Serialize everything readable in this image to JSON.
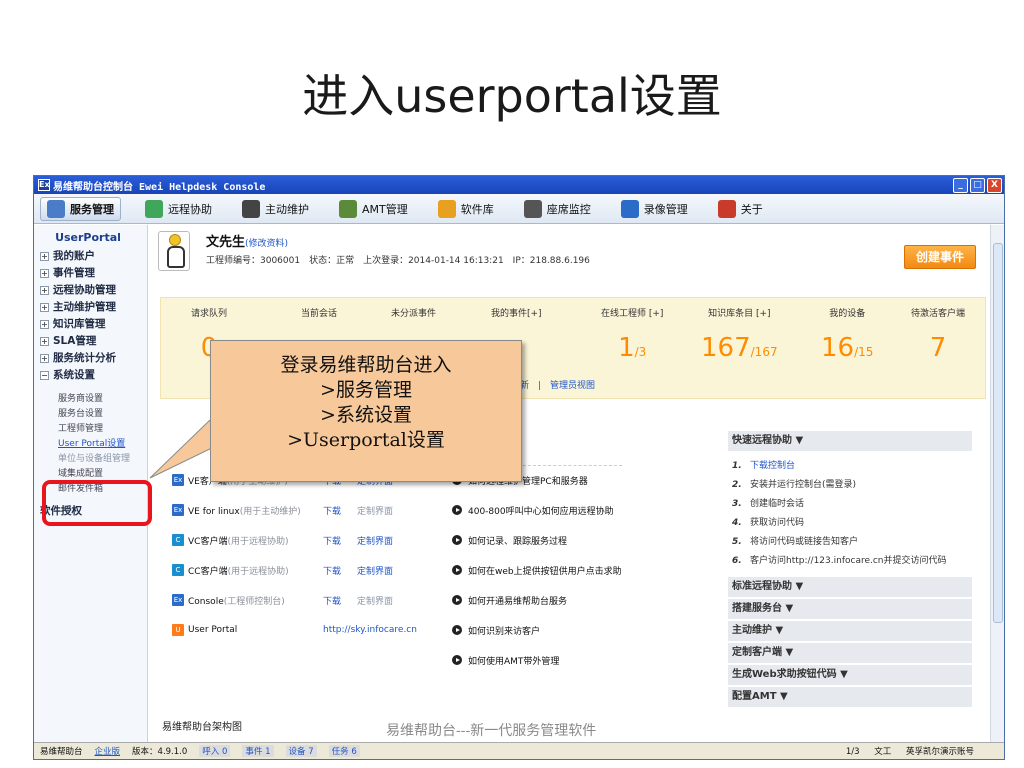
{
  "slide": {
    "title": "进入userportal设置",
    "callout_lines": [
      "登录易维帮助台进入",
      ">服务管理",
      ">系统设置",
      ">Userportal设置"
    ],
    "watermark": "易维帮助台---新一代服务管理软件"
  },
  "window": {
    "title": "易维帮助台控制台 Ewei Helpdesk Console",
    "icon": "Ex",
    "buttons": {
      "minimize": "_",
      "maximize": "□",
      "close": "X"
    }
  },
  "menu": [
    {
      "label": "服务管理",
      "color": "#4a7cc7"
    },
    {
      "label": "远程协助",
      "color": "#3fa65a"
    },
    {
      "label": "主动维护",
      "color": "#444444"
    },
    {
      "label": "AMT管理",
      "color": "#5a8a3a"
    },
    {
      "label": "软件库",
      "color": "#e8a020"
    },
    {
      "label": "座席监控",
      "color": "#555555"
    },
    {
      "label": "录像管理",
      "color": "#2a6cc8"
    },
    {
      "label": "关于",
      "color": "#c83a2a"
    }
  ],
  "sidebar": {
    "header": "UserPortal",
    "items": [
      {
        "label": "我的账户",
        "sign": "+"
      },
      {
        "label": "事件管理",
        "sign": "+"
      },
      {
        "label": "远程协助管理",
        "sign": "+"
      },
      {
        "label": "主动维护管理",
        "sign": "+"
      },
      {
        "label": "知识库管理",
        "sign": "+"
      },
      {
        "label": "SLA管理",
        "sign": "+"
      },
      {
        "label": "服务统计分析",
        "sign": "+"
      },
      {
        "label": "系统设置",
        "sign": "−"
      }
    ],
    "subs": [
      "服务商设置",
      "服务台设置",
      "工程师管理",
      "User Portal设置",
      "单位与设备组管理",
      "域集成配置",
      "邮件发件箱"
    ],
    "license": "软件授权"
  },
  "profile": {
    "name": "文先生",
    "edit": "(修改资料)",
    "info": "工程师编号：3006001　状态：正常　上次登录：2014-01-14 16:13:21　IP：218.88.6.196",
    "create_button": "创建事件"
  },
  "stats": [
    {
      "label": "请求队列",
      "value": "0",
      "sub": ""
    },
    {
      "label": "当前会话",
      "value": "",
      "sub": ""
    },
    {
      "label": "未分派事件",
      "value": "",
      "sub": ""
    },
    {
      "label": "我的事件[+]",
      "value": "",
      "sub": "7"
    },
    {
      "label": "在线工程师 [+]",
      "value": "1",
      "sub": "/3"
    },
    {
      "label": "知识库条目 [+]",
      "value": "167",
      "sub": "/167"
    },
    {
      "label": "我的设备",
      "value": "16",
      "sub": "/15"
    },
    {
      "label": "待激活客户端",
      "value": "7",
      "sub": ""
    }
  ],
  "stat_links": "刷新　|　管理员视图",
  "downloads": [
    {
      "icon": "Ex",
      "name": "VE客户端",
      "note": "(用于主动维护)",
      "download": "下载",
      "custom": "定制界面",
      "custom_gray": false
    },
    {
      "icon": "Ex",
      "name": "VE for linux",
      "note": "(用于主动维护)",
      "download": "下载",
      "custom": "定制界面",
      "custom_gray": true
    },
    {
      "icon": "C",
      "name": "VC客户端",
      "note": "(用于远程协助)",
      "download": "下载",
      "custom": "定制界面",
      "custom_gray": false
    },
    {
      "icon": "C",
      "name": "CC客户端",
      "note": "(用于远程协助)",
      "download": "下载",
      "custom": "定制界面",
      "custom_gray": false
    },
    {
      "icon": "Ex",
      "name": "Console",
      "note": "(工程师控制台)",
      "download": "下载",
      "custom": "定制界面",
      "custom_gray": true
    },
    {
      "icon": "U",
      "name": "User Portal",
      "note": "",
      "download": "http://sky.infocare.cn",
      "custom": "",
      "custom_gray": false
    }
  ],
  "faq": [
    "如何远程维护管理PC和服务器",
    "400-800呼叫中心如何应用远程协助",
    "如何记录、跟踪服务过程",
    "如何在web上提供按钮供用户点击求助",
    "如何开通易维帮助台服务",
    "如何识别来访客户",
    "如何使用AMT带外管理"
  ],
  "right_panel": {
    "quick_head": "快速远程协助 ▼",
    "quick_steps": [
      {
        "n": "1.",
        "text": "下载控制台",
        "link": true
      },
      {
        "n": "2.",
        "text": "安装并运行控制台(需登录)",
        "link": false
      },
      {
        "n": "3.",
        "text": "创建临时会话",
        "link": false
      },
      {
        "n": "4.",
        "text": "获取访问代码",
        "link": false
      },
      {
        "n": "5.",
        "text": "将访问代码或链接告知客户",
        "link": false
      },
      {
        "n": "6.",
        "text": "客户访问http://123.infocare.cn并提交访问代码",
        "link": false
      }
    ],
    "sections": [
      "标准远程协助 ▼",
      "搭建服务台 ▼",
      "主动维护 ▼",
      "定制客户端 ▼",
      "生成Web求助按钮代码 ▼",
      "配置AMT ▼"
    ]
  },
  "arch_label": "易维帮助台架构图",
  "statusbar": {
    "app": "易维帮助台",
    "edition": "企业版",
    "version": "版本：4.9.1.0",
    "call": "呼入 0",
    "events": "事件 1",
    "devices": "设备 7",
    "tasks": "任务 6",
    "online": "1/3",
    "user": "文工",
    "account": "英孚凯尔演示账号"
  }
}
